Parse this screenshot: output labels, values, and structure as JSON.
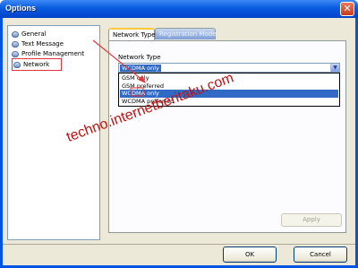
{
  "window": {
    "title": "Options",
    "close_glyph": "✕"
  },
  "tree": {
    "items": [
      {
        "label": "General"
      },
      {
        "label": "Text Message"
      },
      {
        "label": "Profile Management"
      },
      {
        "label": "Network"
      }
    ]
  },
  "tabs": [
    {
      "label": "Network Type"
    },
    {
      "label": "Registration Mode"
    }
  ],
  "network_type": {
    "label": "Network Type",
    "selected": "WCDMA only",
    "options": [
      "GSM only",
      "GSM preferred",
      "WCDMA only",
      "WCDMA preferred"
    ]
  },
  "buttons": {
    "apply": "Apply",
    "ok": "OK",
    "cancel": "Cancel"
  },
  "watermark": "techno.internetberitaku.com",
  "colors": {
    "annotation": "#e3343a",
    "selection": "#316ac5",
    "title_bar": "#0a5be0"
  }
}
